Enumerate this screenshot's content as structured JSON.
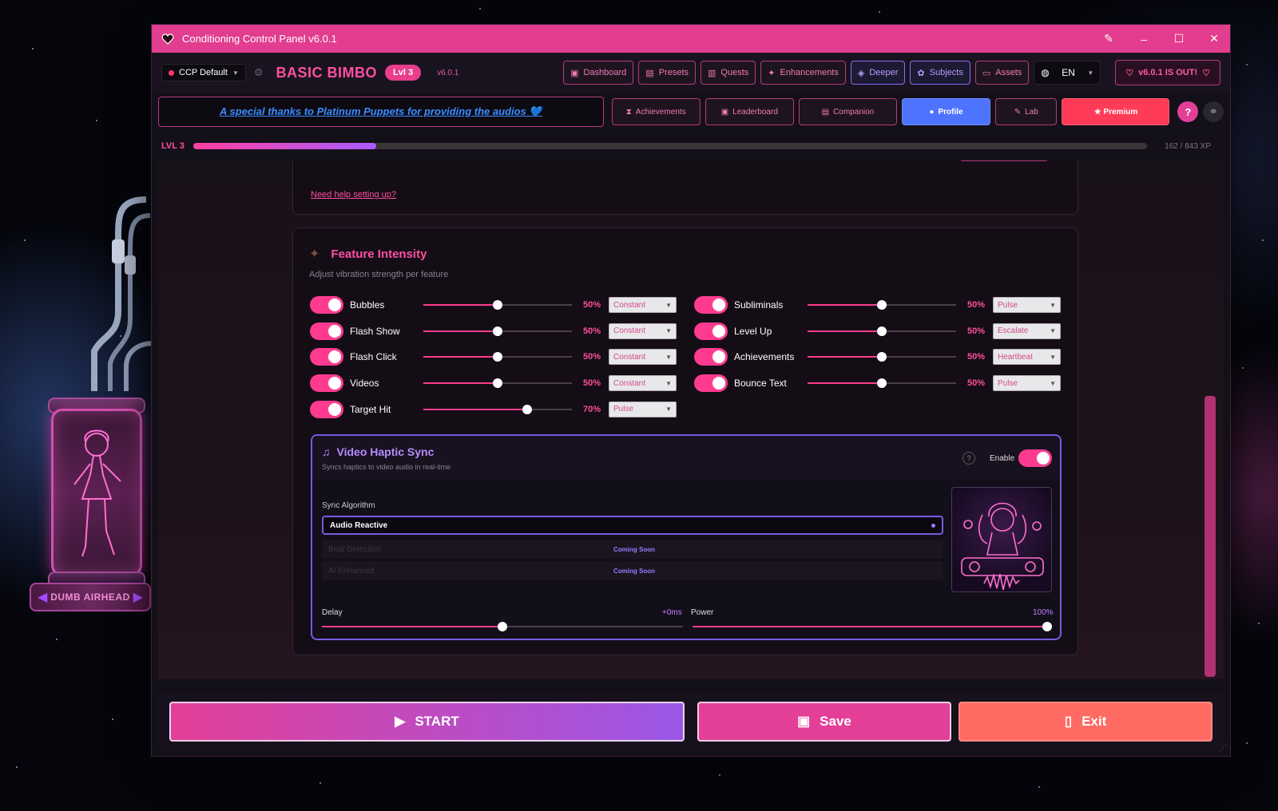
{
  "window": {
    "title": "Conditioning Control Panel v6.0.1"
  },
  "header": {
    "preset": "CCP Default",
    "brand": "BASIC BIMBO",
    "level_badge": "Lvl 3",
    "version": "v6.0.1",
    "nav": [
      {
        "label": "Dashboard",
        "icon": "dashboard-icon"
      },
      {
        "label": "Presets",
        "icon": "presets-icon"
      },
      {
        "label": "Quests",
        "icon": "quests-icon"
      },
      {
        "label": "Enhancements",
        "icon": "sparkle-icon"
      },
      {
        "label": "Deeper",
        "icon": "deeper-icon"
      },
      {
        "label": "Subjects",
        "icon": "subjects-icon"
      },
      {
        "label": "Assets",
        "icon": "folder-icon"
      }
    ],
    "language": "EN",
    "update_notice": "v6.0.1 IS OUT!"
  },
  "banner": {
    "text": "A special thanks to Platinum Puppets for providing the audios 💙"
  },
  "tabs": [
    {
      "label": "Achievements",
      "icon": "hourglass-icon"
    },
    {
      "label": "Leaderboard",
      "icon": "trophy-icon"
    },
    {
      "label": "Companion",
      "icon": "companion-icon"
    },
    {
      "label": "Profile",
      "icon": "user-icon"
    },
    {
      "label": "Lab",
      "icon": "lab-icon"
    },
    {
      "label": "★ Premium",
      "icon": "star-icon"
    }
  ],
  "xp": {
    "level_label": "LVL 3",
    "progress_fraction": 0.192,
    "text": "162 / 843 XP"
  },
  "help_link": "Need help setting up?",
  "feature_intensity": {
    "title": "Feature Intensity",
    "subtitle": "Adjust vibration strength per feature",
    "left": [
      {
        "name": "Bubbles",
        "enabled": true,
        "value": 50,
        "pct": "50%",
        "mode": "Constant"
      },
      {
        "name": "Flash Show",
        "enabled": true,
        "value": 50,
        "pct": "50%",
        "mode": "Constant"
      },
      {
        "name": "Flash Click",
        "enabled": true,
        "value": 50,
        "pct": "50%",
        "mode": "Constant"
      },
      {
        "name": "Videos",
        "enabled": true,
        "value": 50,
        "pct": "50%",
        "mode": "Constant"
      },
      {
        "name": "Target Hit",
        "enabled": true,
        "value": 70,
        "pct": "70%",
        "mode": "Pulse"
      }
    ],
    "right": [
      {
        "name": "Subliminals",
        "enabled": true,
        "value": 50,
        "pct": "50%",
        "mode": "Pulse"
      },
      {
        "name": "Level Up",
        "enabled": true,
        "value": 50,
        "pct": "50%",
        "mode": "Escalate"
      },
      {
        "name": "Achievements",
        "enabled": true,
        "value": 50,
        "pct": "50%",
        "mode": "Heartbeat"
      },
      {
        "name": "Bounce Text",
        "enabled": true,
        "value": 50,
        "pct": "50%",
        "mode": "Pulse"
      }
    ]
  },
  "video_haptic_sync": {
    "title": "Video Haptic Sync",
    "subtitle": "Syncs haptics to video audio in real-time",
    "help": "?",
    "enable_label": "Enable",
    "algorithm_label": "Sync Algorithm",
    "selected": "Audio Reactive",
    "options": [
      {
        "label": "Beat Detection",
        "status": "Coming Soon"
      },
      {
        "label": "AI Enhanced",
        "status": "Coming Soon"
      }
    ],
    "delay": {
      "label": "Delay",
      "value_text": "+0ms",
      "fraction": 0.5
    },
    "power": {
      "label": "Power",
      "value_text": "100%",
      "fraction": 1.0
    }
  },
  "character": {
    "name": "DUMB AIRHEAD"
  },
  "buttons": {
    "start": "START",
    "save": "Save",
    "exit": "Exit"
  },
  "colors": {
    "accent": "#e23d8f",
    "pink": "#ff4fa0",
    "purple": "#9b57e8",
    "blue_active": "#4d73ff",
    "premium": "#ff3b58",
    "exit": "#ff6b63"
  }
}
